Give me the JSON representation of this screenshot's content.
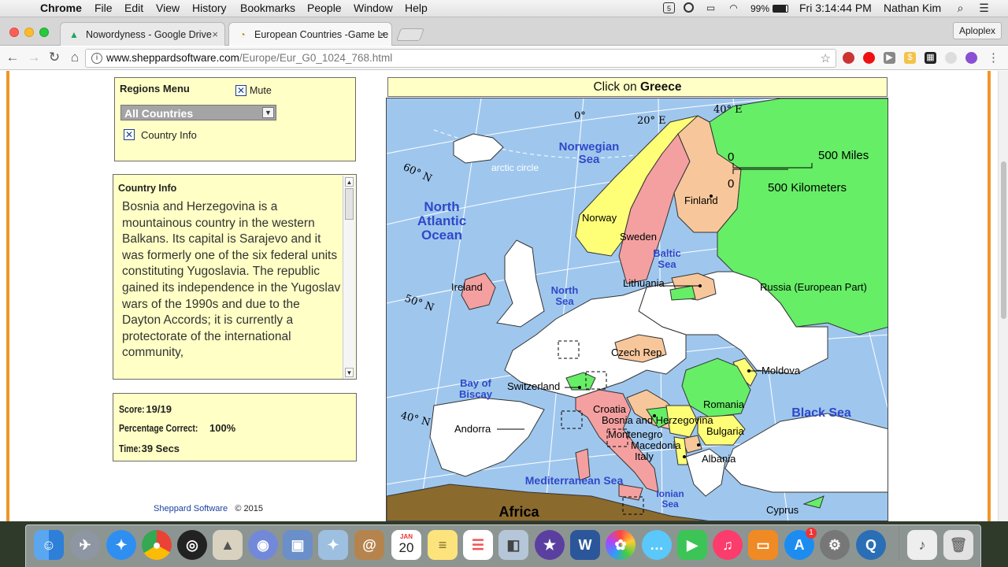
{
  "menubar": {
    "apple_icon": "apple-icon",
    "app_name": "Chrome",
    "menus": [
      "File",
      "Edit",
      "View",
      "History",
      "Bookmarks",
      "People",
      "Window",
      "Help"
    ],
    "battery": "99%",
    "clock": "Fri 3:14:44 PM",
    "user": "Nathan Kim"
  },
  "tabs": [
    {
      "title": "Nowordyness - Google Drive",
      "icon": "google-drive-icon",
      "close": "×"
    },
    {
      "title": "European Countries -Game Le",
      "icon": "sheppard-software-icon",
      "close": "×"
    }
  ],
  "profile_button": "Aploplex",
  "address": {
    "host": "www.sheppardsoftware.com",
    "path": "/Europe/Eur_G0_1024_768.html"
  },
  "regions_menu": {
    "title": "Regions Menu",
    "mute_label": "Mute",
    "mute_checked": "✕",
    "select_value": "All Countries",
    "country_info_label": "Country Info",
    "country_info_checked": "✕"
  },
  "country_info": {
    "title": "Country Info",
    "text": "Bosnia and Herzegovina is a mountainous country in the western Balkans. Its capital is Sarajevo and it was formerly one of the six federal units constituting Yugoslavia. The republic gained its independence in the Yugoslav wars of the 1990s and due to the Dayton Accords; it is currently a protectorate of the international community,"
  },
  "score": {
    "score_label": "Score:",
    "score_value": "19/19",
    "pct_label": "Percentage Correct:",
    "pct_value": "100%",
    "time_label": "Time:",
    "time_value": "39 Secs"
  },
  "footer": {
    "link": "Sheppard Software",
    "copyright": "© 2015"
  },
  "game": {
    "prompt_prefix": "Click on",
    "target_country": "Greece"
  },
  "map": {
    "seas": {
      "norwegian_1": "Norwegian",
      "norwegian_2": "Sea",
      "north_atlantic_1": "North",
      "north_atlantic_2": "Atlantic",
      "north_atlantic_3": "Ocean",
      "baltic_1": "Baltic",
      "baltic_2": "Sea",
      "north_sea_1": "North",
      "north_sea_2": "Sea",
      "biscay_1": "Bay of",
      "biscay_2": "Biscay",
      "black_sea": "Black Sea",
      "mediterranean": "Mediterranean Sea",
      "ionian_1": "Ionian",
      "ionian_2": "Sea",
      "africa": "Africa"
    },
    "grid": {
      "arctic": "arctic circle",
      "lon0": "0°",
      "lon20": "20° E",
      "lon40": "40° E",
      "lat60": "60° N",
      "lat50": "50° N",
      "lat40": "40° N"
    },
    "scale": {
      "miles": "500 Miles",
      "km": "500 Kilometers",
      "zero_a": "0",
      "zero_b": "0"
    },
    "countries": {
      "norway": "Norway",
      "sweden": "Sweden",
      "finland": "Finland",
      "ireland": "Ireland",
      "lithuania": "Lithuania",
      "russia": "Russia (European Part)",
      "czech": "Czech Rep.",
      "moldova": "Moldova",
      "switzerland": "Switzerland",
      "romania": "Romania",
      "croatia": "Croatia",
      "bosnia": "Bosnia and Herzegovina",
      "bulgaria": "Bulgaria",
      "montenegro": "Montenegro",
      "macedonia": "Macedonia",
      "italy": "Italy",
      "albania": "Albania",
      "andorra": "Andorra",
      "cyprus": "Cyprus"
    },
    "colors": {
      "sea": "#9fc7ee",
      "land": "#ffffff",
      "green": "#66ee66",
      "yellow": "#ffff77",
      "salmon": "#f4a0a0",
      "tan": "#f7c79b",
      "brown": "#8b6a2e"
    }
  },
  "dock": {
    "calendar_month": "JAN",
    "calendar_day": "20",
    "appstore_badge": "1",
    "icons": [
      "finder-icon",
      "launchpad-icon",
      "safari-icon",
      "chrome-icon",
      "obs-icon",
      "preview-icon",
      "discord-icon",
      "virtualbox-icon",
      "photo-icon",
      "contacts-icon",
      "calendar-icon",
      "notes-icon",
      "reminders-icon",
      "photo-booth-icon",
      "imovie-icon",
      "word-icon",
      "photos-icon",
      "messages-icon",
      "facetime-icon",
      "itunes-icon",
      "ibooks-icon",
      "app-store-icon",
      "system-preferences-icon",
      "quicktime-icon",
      "itunes-file-icon",
      "trash-icon"
    ]
  }
}
